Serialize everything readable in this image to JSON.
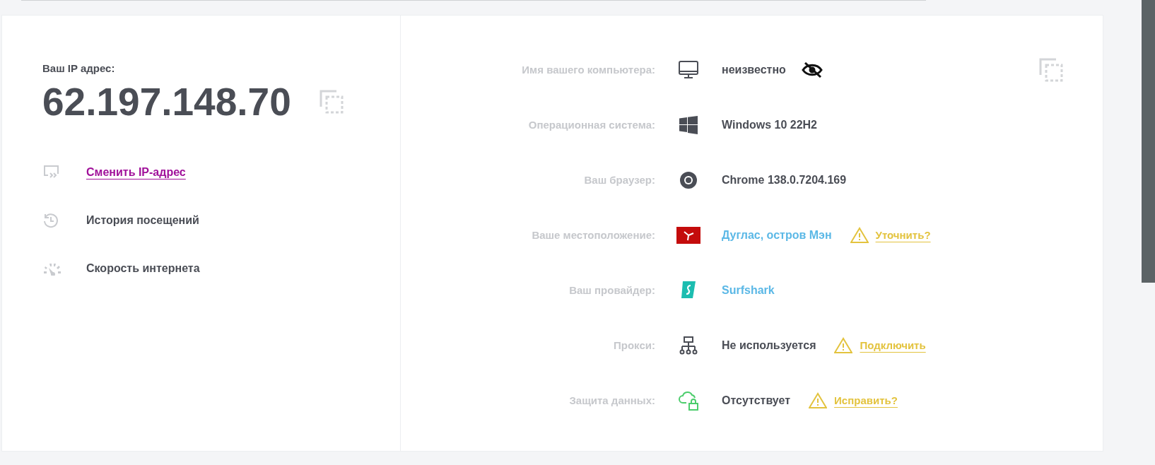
{
  "ip_panel": {
    "label": "Ваш IP адрес:",
    "ip": "62.197.148.70"
  },
  "actions": [
    {
      "kind": "change",
      "label": "Сменить IP-адрес",
      "link": true
    },
    {
      "kind": "history",
      "label": "История посещений",
      "link": false
    },
    {
      "kind": "speed",
      "label": "Скорость интернета",
      "link": false
    }
  ],
  "info_rows": [
    {
      "label": "Имя вашего компьютера:",
      "kind": "computer",
      "value": "неизвестно",
      "link": false,
      "hidden": true
    },
    {
      "label": "Операционная система:",
      "kind": "windows",
      "value": "Windows 10 22H2",
      "link": false,
      "hidden": false
    },
    {
      "label": "Ваш браузер:",
      "kind": "browser",
      "value": "Chrome 138.0.7204.169",
      "link": false,
      "hidden": false
    },
    {
      "label": "Ваше местоположение:",
      "kind": "flag",
      "value": "Дуглас, остров Мэн",
      "link": true,
      "hidden": false,
      "warning": "Уточнить?"
    },
    {
      "label": "Ваш провайдер:",
      "kind": "provider",
      "value": "Surfshark",
      "link": true,
      "hidden": false
    },
    {
      "label": "Прокси:",
      "kind": "proxy",
      "value": "Не используется",
      "link": false,
      "hidden": false,
      "warning": "Подключить"
    },
    {
      "label": "Защита данных:",
      "kind": "cloud-lock",
      "value": "Отсутствует",
      "link": false,
      "hidden": false,
      "warning": "Исправить?"
    }
  ]
}
